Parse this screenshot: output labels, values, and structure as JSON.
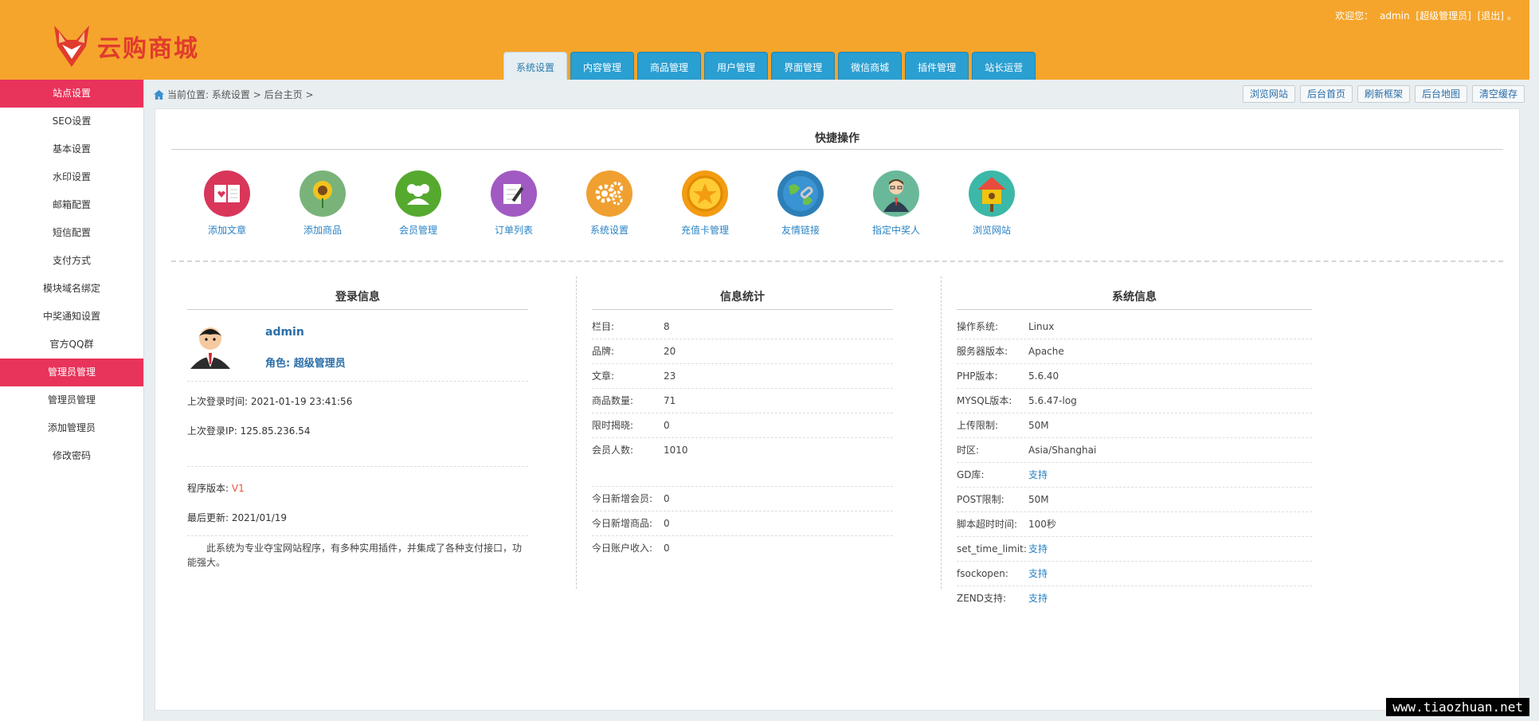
{
  "header": {
    "logo_text": "云购商城",
    "welcome": "欢迎您：",
    "user": "admin",
    "role_tag": "[超级管理员]",
    "logout": "[退出]",
    "tail": "。"
  },
  "topnav": [
    "系统设置",
    "内容管理",
    "商品管理",
    "用户管理",
    "界面管理",
    "微信商城",
    "插件管理",
    "站长运营"
  ],
  "sidebar": {
    "group1": "站点设置",
    "items1": [
      "SEO设置",
      "基本设置",
      "水印设置",
      "邮箱配置",
      "短信配置",
      "支付方式",
      "模块域名绑定",
      "中奖通知设置",
      "官方QQ群"
    ],
    "group2": "管理员管理",
    "items2": [
      "管理员管理",
      "添加管理员",
      "修改密码"
    ]
  },
  "breadcrumb": {
    "prefix": "当前位置:",
    "path1": "系统设置",
    "sep": ">",
    "path2": "后台主页",
    "sep2": ">"
  },
  "top_buttons": [
    "浏览网站",
    "后台首页",
    "刷新框架",
    "后台地图",
    "清空缓存"
  ],
  "quick": {
    "title": "快捷操作",
    "items": [
      {
        "label": "添加文章",
        "icon": "book-icon",
        "color": "#d9365a"
      },
      {
        "label": "添加商品",
        "icon": "sunflower-icon",
        "color": "#7ab37a"
      },
      {
        "label": "会员管理",
        "icon": "users-icon",
        "color": "#55a92f"
      },
      {
        "label": "订单列表",
        "icon": "notepad-icon",
        "color": "#a15ac2"
      },
      {
        "label": "系统设置",
        "icon": "gears-icon",
        "color": "#f0a030"
      },
      {
        "label": "充值卡管理",
        "icon": "coin-icon",
        "color": "#f39c12"
      },
      {
        "label": "友情链接",
        "icon": "globe-link-icon",
        "color": "#2d7fb8"
      },
      {
        "label": "指定中奖人",
        "icon": "person-icon",
        "color": "#6ab89a"
      },
      {
        "label": "浏览网站",
        "icon": "birdhouse-icon",
        "color": "#3cb8a8"
      }
    ]
  },
  "login": {
    "title": "登录信息",
    "username": "admin",
    "role": "角色: 超级管理员",
    "last_time_label": "上次登录时间:",
    "last_time": "2021-01-19 23:41:56",
    "last_ip_label": "上次登录IP:",
    "last_ip": "125.85.236.54",
    "version_label": "程序版本:",
    "version": "V1",
    "updated_label": "最后更新:",
    "updated": "2021/01/19",
    "description": "此系统为专业夺宝网站程序，有多种实用插件，并集成了各种支付接口，功能强大。"
  },
  "stats": {
    "title": "信息统计",
    "rows1": [
      {
        "k": "栏目:",
        "v": "8"
      },
      {
        "k": "品牌:",
        "v": "20"
      },
      {
        "k": "文章:",
        "v": "23"
      },
      {
        "k": "商品数量:",
        "v": "71"
      },
      {
        "k": "限时揭晓:",
        "v": "0"
      },
      {
        "k": "会员人数:",
        "v": "1010"
      }
    ],
    "rows2": [
      {
        "k": "今日新增会员:",
        "v": "0"
      },
      {
        "k": "今日新增商品:",
        "v": "0"
      },
      {
        "k": "今日账户收入:",
        "v": "0"
      }
    ]
  },
  "sysinfo": {
    "title": "系统信息",
    "rows": [
      {
        "k": "操作系统:",
        "v": "Linux"
      },
      {
        "k": "服务器版本:",
        "v": "Apache"
      },
      {
        "k": "PHP版本:",
        "v": "5.6.40"
      },
      {
        "k": "MYSQL版本:",
        "v": "5.6.47-log"
      },
      {
        "k": "上传限制:",
        "v": "50M"
      },
      {
        "k": "时区:",
        "v": "Asia/Shanghai"
      },
      {
        "k": "GD库:",
        "v": "支持"
      },
      {
        "k": "POST限制:",
        "v": "50M"
      },
      {
        "k": "脚本超时时间:",
        "v": "100秒"
      },
      {
        "k": "set_time_limit:",
        "v": "支持"
      },
      {
        "k": "fsockopen:",
        "v": "支持"
      },
      {
        "k": "ZEND支持:",
        "v": "支持"
      }
    ]
  },
  "watermark": "www.tiaozhuan.net"
}
